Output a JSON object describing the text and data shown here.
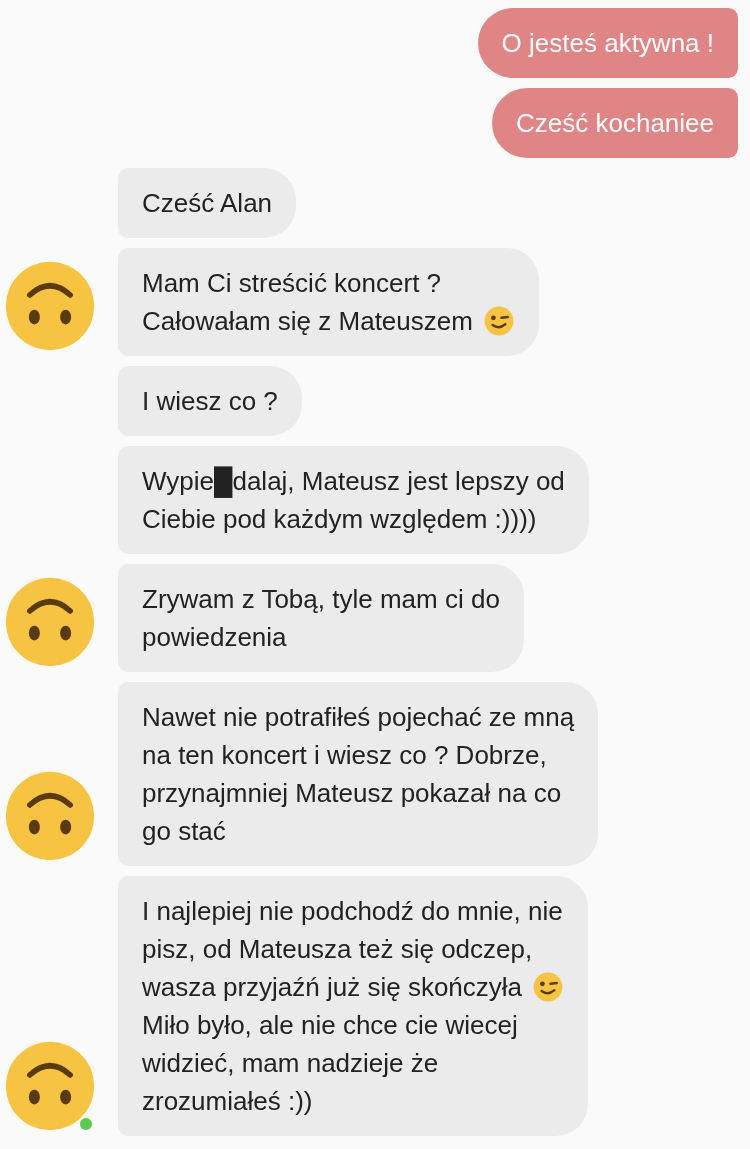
{
  "messages": [
    {
      "kind": "outgoing",
      "parts": [
        {
          "kind": "text",
          "text": "O jesteś aktywna !"
        }
      ]
    },
    {
      "kind": "outgoing",
      "parts": [
        {
          "kind": "text",
          "text": "Cześć kochaniee"
        }
      ]
    },
    {
      "kind": "incoming",
      "avatar": false,
      "parts": [
        {
          "kind": "text",
          "text": "Cześć Alan"
        }
      ]
    },
    {
      "kind": "incoming",
      "avatar": true,
      "parts": [
        {
          "kind": "text",
          "text": "Mam Ci streścić koncert ?"
        },
        {
          "kind": "text_emoji",
          "text": "Całowałam się z Mateuszem"
        }
      ]
    },
    {
      "kind": "incoming",
      "avatar": false,
      "parts": [
        {
          "kind": "text",
          "text": "I wiesz co ?"
        }
      ]
    },
    {
      "kind": "incoming",
      "avatar": false,
      "parts": [
        {
          "kind": "text",
          "text": "Wypie█dalaj, Mateusz jest lepszy od\nCiebie pod każdym względem :))))"
        }
      ]
    },
    {
      "kind": "incoming",
      "avatar": true,
      "parts": [
        {
          "kind": "text",
          "text": "Zrywam z Tobą, tyle mam ci do\npowiedzenia"
        }
      ]
    },
    {
      "kind": "incoming",
      "avatar": true,
      "parts": [
        {
          "kind": "text",
          "text": "Nawet nie potrafiłeś pojechać ze mną\nna ten koncert i wiesz co ? Dobrze,\nprzynajmniej Mateusz pokazał na co\ngo stać"
        }
      ]
    },
    {
      "kind": "incoming",
      "avatar": true,
      "online": true,
      "parts": [
        {
          "kind": "text",
          "text": "I najlepiej nie podchodź do mnie, nie\npisz, od Mateusza też się odczep,"
        },
        {
          "kind": "text_emoji",
          "text": "wasza przyjaźń już się skończyła"
        },
        {
          "kind": "text",
          "text": "Miło było, ale nie chce cie wiecej\nwidzieć, mam nadzieje że\nzrozumiałeś :))"
        }
      ]
    }
  ]
}
